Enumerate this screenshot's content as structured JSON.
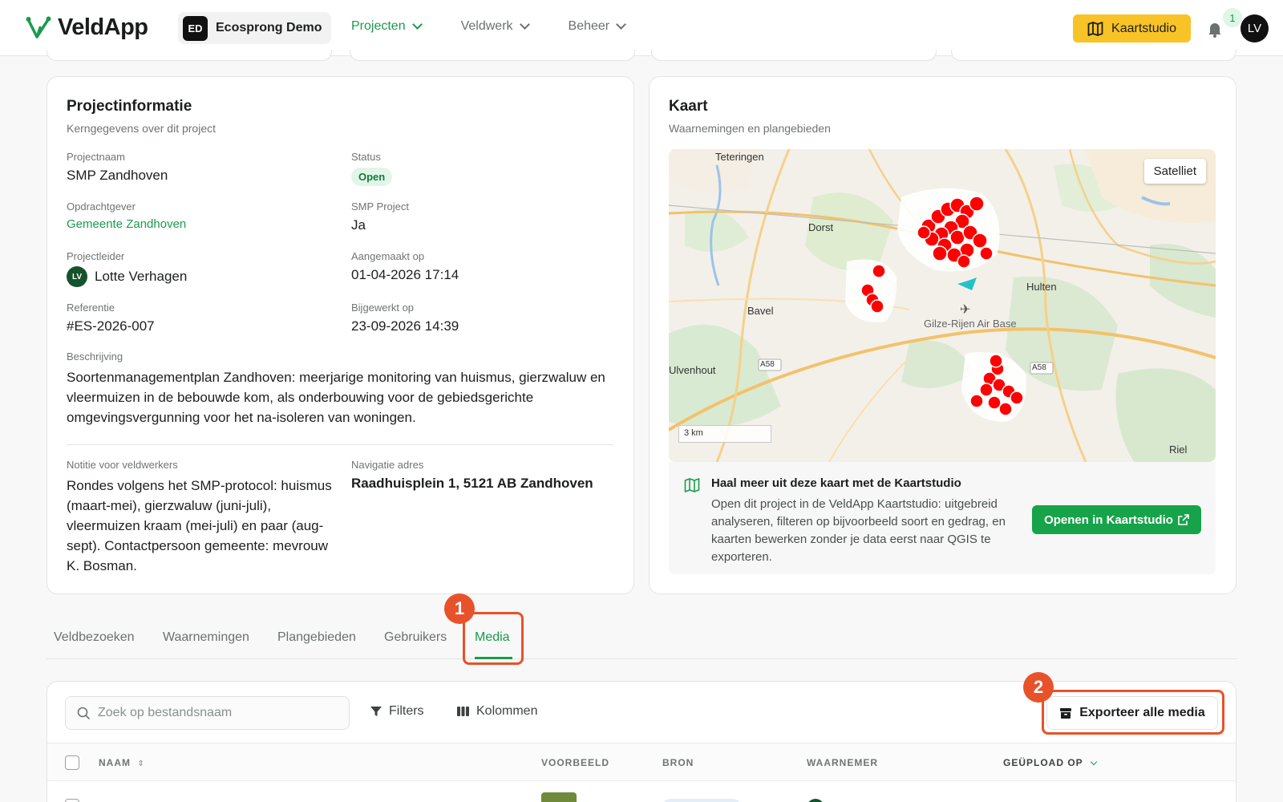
{
  "header": {
    "app_name": "VeldApp",
    "org_initials": "ED",
    "org_name": "Ecosprong Demo",
    "nav": [
      {
        "label": "Projecten",
        "active": true
      },
      {
        "label": "Veldwerk",
        "active": false
      },
      {
        "label": "Beheer",
        "active": false
      }
    ],
    "studio_button": "Kaartstudio",
    "notification_count": "1",
    "user_initials": "LV"
  },
  "project_info": {
    "title": "Projectinformatie",
    "subtitle": "Kerngegevens over dit project",
    "name_label": "Projectnaam",
    "name_value": "SMP Zandhoven",
    "status_label": "Status",
    "status_value": "Open",
    "client_label": "Opdrachtgever",
    "client_value": "Gemeente Zandhoven",
    "smp_label": "SMP Project",
    "smp_value": "Ja",
    "lead_label": "Projectleider",
    "lead_initials": "LV",
    "lead_value": "Lotte Verhagen",
    "created_label": "Aangemaakt op",
    "created_value": "01-04-2026 17:14",
    "ref_label": "Referentie",
    "ref_value": "#ES-2026-007",
    "updated_label": "Bijgewerkt op",
    "updated_value": "23-09-2026 14:39",
    "desc_label": "Beschrijving",
    "desc_value": "Soortenmanagementplan Zandhoven: meerjarige monitoring van huismus, gierzwaluw en vleermuizen in de bebouwde kom, als onderbouwing voor de gebiedsgerichte omgevingsvergunning voor het na-isoleren van woningen.",
    "note_label": "Notitie voor veldwerkers",
    "note_value": "Rondes volgens het SMP-protocol: huismus (maart-mei), gierzwaluw (juni-juli), vleermuizen kraam (mei-juli) en paar (aug-sept). Contactpersoon gemeente: mevrouw K. Bosman.",
    "address_label": "Navigatie adres",
    "address_value": "Raadhuisplein 1, 5121 AB Zandhoven"
  },
  "map_card": {
    "title": "Kaart",
    "subtitle": "Waarnemingen en plangebieden",
    "satellite_button": "Satelliet",
    "scale_label": "3 km",
    "places": [
      "Teteringen",
      "Dorst",
      "Hulten",
      "Bavel",
      "Gilze-Rijen Air Base",
      "Ulvenhout",
      "A58",
      "A58",
      "Riel"
    ],
    "promo_title": "Haal meer uit deze kaart met de Kaartstudio",
    "promo_text": "Open dit project in de VeldApp Kaartstudio: uitgebreid analyseren, filteren op bijvoorbeeld soort en gedrag, en kaarten bewerken zonder je data eerst naar QGIS te exporteren.",
    "promo_button": "Openen in Kaartstudio"
  },
  "tabs": [
    {
      "label": "Veldbezoeken"
    },
    {
      "label": "Waarnemingen"
    },
    {
      "label": "Plangebieden"
    },
    {
      "label": "Gebruikers"
    },
    {
      "label": "Media",
      "active": true
    }
  ],
  "callouts": {
    "first": "1",
    "second": "2"
  },
  "media": {
    "search_placeholder": "Zoek op bestandsnaam",
    "filters_label": "Filters",
    "columns_label": "Kolommen",
    "export_label": "Exporteer alle media",
    "columns": [
      "NAAM",
      "VOORBEELD",
      "BRON",
      "WAARNEMER",
      "GEÜPLOAD OP"
    ]
  },
  "colors": {
    "accent_green": "#1a9b4b",
    "studio_yellow": "#f8c326",
    "callout_orange": "#e8522a",
    "marker_red": "#ff0000"
  }
}
